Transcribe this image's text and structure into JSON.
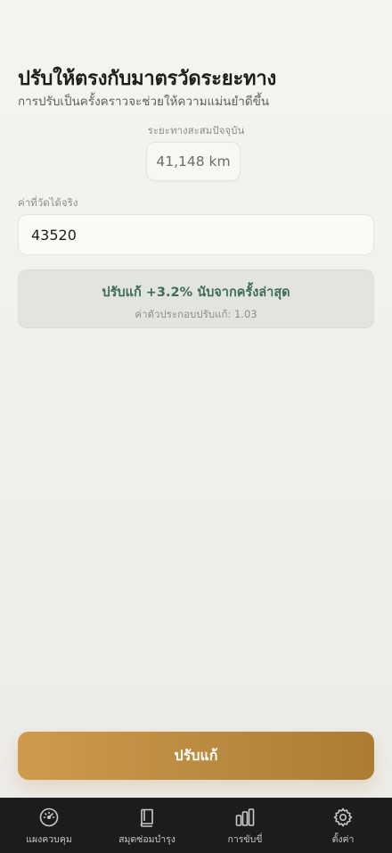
{
  "header": {
    "title": "ปรับให้ตรงกับมาตรวัดระยะทาง",
    "subtitle": "การปรับเป็นครั้งคราวจะช่วยให้ความแม่นยำดีขึ้น"
  },
  "odometer": {
    "label": "ระยะทางสะสมปัจจุบัน",
    "value": "41,148 km"
  },
  "actual": {
    "label": "ค่าที่วัดได้จริง",
    "value": "43520"
  },
  "result": {
    "main": "ปรับแก้ +3.2% นับจากครั้งล่าสุด",
    "sub": "ค่าตัวประกอบปรับแก้: 1.03"
  },
  "action": {
    "label": "ปรับแก้"
  },
  "tabs": [
    {
      "label": "แผงควบคุม",
      "icon": "speedometer-icon"
    },
    {
      "label": "สมุดซ่อมบำรุง",
      "icon": "book-icon"
    },
    {
      "label": "การขับขี่",
      "icon": "bar-chart-icon"
    },
    {
      "label": "ตั้งค่า",
      "icon": "gear-icon"
    }
  ],
  "colors": {
    "accent": "#c08c43",
    "result_text": "#3f6b58",
    "result_bg": "#e2e5df",
    "tabbar_bg": "#1c1c1c"
  }
}
